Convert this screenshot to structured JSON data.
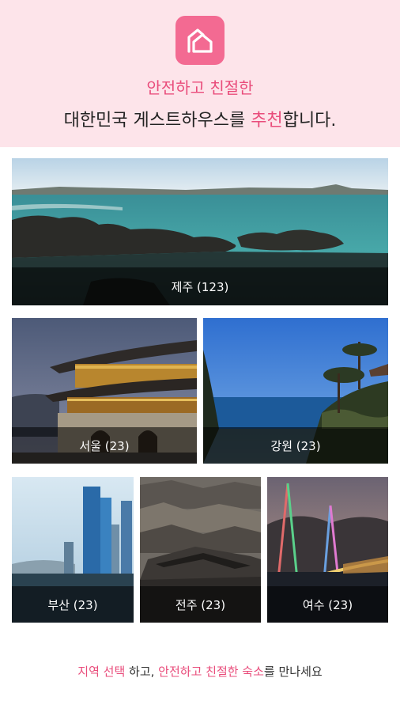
{
  "header": {
    "logo_icon": "house-icon",
    "tagline_line1": "안전하고 친절한",
    "tagline_line2_prefix": "대한민국 게스트하우스를 ",
    "tagline_line2_accent": "추천",
    "tagline_line2_suffix": "합니다.",
    "accent_color": "#e94c7b",
    "background_color": "#fde4ea"
  },
  "regions": [
    {
      "name": "제주",
      "count": "(123)",
      "label": "제주 (123)"
    },
    {
      "name": "서울",
      "count": "(23)",
      "label": "서울 (23)"
    },
    {
      "name": "강원",
      "count": "(23)",
      "label": "강원 (23)"
    },
    {
      "name": "부산",
      "count": "(23)",
      "label": "부산 (23)"
    },
    {
      "name": "전주",
      "count": "(23)",
      "label": "전주 (23)"
    },
    {
      "name": "여수",
      "count": "(23)",
      "label": "여수 (23)"
    }
  ],
  "footer": {
    "part1_accent": "지역 선택",
    "part2": " 하고, ",
    "part3_accent": "안전하고 친절한 숙소",
    "part4": "를 만나세요"
  }
}
